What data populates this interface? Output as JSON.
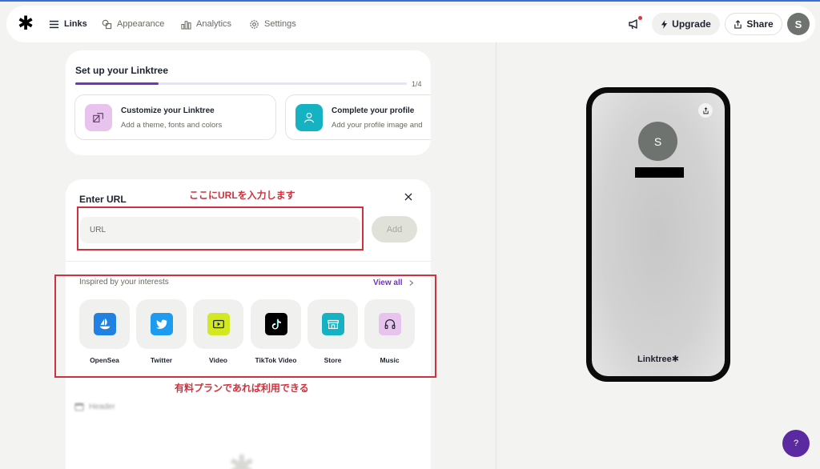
{
  "nav": {
    "logo": "✱",
    "items": [
      {
        "label": "Links",
        "icon": "links-icon",
        "active": true
      },
      {
        "label": "Appearance",
        "icon": "shapes-icon",
        "active": false
      },
      {
        "label": "Analytics",
        "icon": "bar-chart-icon",
        "active": false
      },
      {
        "label": "Settings",
        "icon": "gear-icon",
        "active": false
      }
    ],
    "upgrade_label": "Upgrade",
    "share_label": "Share",
    "avatar_initial": "S"
  },
  "setup": {
    "title": "Set up your Linktree",
    "progress_text": "1/4",
    "progress_fraction": 0.25,
    "tasks": [
      {
        "title": "Customize your Linktree",
        "subtitle": "Add a theme, fonts and colors",
        "color": "#e8c3ee"
      },
      {
        "title": "Complete your profile",
        "subtitle": "Add your profile image and",
        "color": "#15b2c4"
      }
    ]
  },
  "url_panel": {
    "title": "Enter URL",
    "input_placeholder": "URL",
    "add_label": "Add",
    "inspired_label": "Inspired by your interests",
    "view_all_label": "View all",
    "tiles": [
      {
        "label": "OpenSea",
        "icon": "opensea-icon",
        "bg": "#2081e2"
      },
      {
        "label": "Twitter",
        "icon": "twitter-icon",
        "bg": "#1d9bf0"
      },
      {
        "label": "Video",
        "icon": "video-icon",
        "bg": "#d2e823"
      },
      {
        "label": "TikTok Video",
        "icon": "tiktok-icon",
        "bg": "#000000"
      },
      {
        "label": "Store",
        "icon": "store-icon",
        "bg": "#15b2c4"
      },
      {
        "label": "Music",
        "icon": "headphones-icon",
        "bg": "#e8c3ee"
      }
    ]
  },
  "annotations": {
    "note_url": "ここにURLを入力します",
    "note_paid": "有料プランであれば利用できる"
  },
  "section": {
    "header_label": "Header"
  },
  "preview": {
    "avatar_initial": "S",
    "brand": "Linktree✱"
  },
  "help_label": "?"
}
